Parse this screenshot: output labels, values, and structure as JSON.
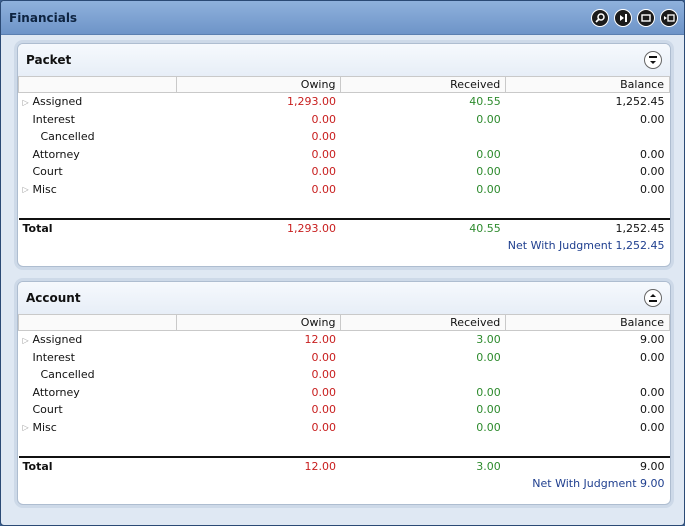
{
  "window": {
    "title": "Financials"
  },
  "colors": {
    "owing": "#c81e1e",
    "received": "#2e8b2e",
    "net": "#1f3f8f"
  },
  "panels": [
    {
      "title": "Packet",
      "columns": [
        "Owing",
        "Received",
        "Balance"
      ],
      "rows": [
        {
          "label": "Assigned",
          "expandable": true,
          "indent": 0,
          "owing": "1,293.00",
          "received": "40.55",
          "balance": "1,252.45"
        },
        {
          "label": "Interest",
          "expandable": false,
          "indent": 1,
          "owing": "0.00",
          "received": "0.00",
          "balance": "0.00"
        },
        {
          "label": "Cancelled",
          "expandable": false,
          "indent": 2,
          "owing": "0.00",
          "received": "",
          "balance": ""
        },
        {
          "label": "Attorney",
          "expandable": false,
          "indent": 1,
          "owing": "0.00",
          "received": "0.00",
          "balance": "0.00"
        },
        {
          "label": "Court",
          "expandable": false,
          "indent": 1,
          "owing": "0.00",
          "received": "0.00",
          "balance": "0.00"
        },
        {
          "label": "Misc",
          "expandable": true,
          "indent": 0,
          "owing": "0.00",
          "received": "0.00",
          "balance": "0.00"
        }
      ],
      "total": {
        "label": "Total",
        "owing": "1,293.00",
        "received": "40.55",
        "balance": "1,252.45"
      },
      "net": "Net With Judgment 1,252.45"
    },
    {
      "title": "Account",
      "columns": [
        "Owing",
        "Received",
        "Balance"
      ],
      "rows": [
        {
          "label": "Assigned",
          "expandable": true,
          "indent": 0,
          "owing": "12.00",
          "received": "3.00",
          "balance": "9.00"
        },
        {
          "label": "Interest",
          "expandable": false,
          "indent": 1,
          "owing": "0.00",
          "received": "0.00",
          "balance": "0.00"
        },
        {
          "label": "Cancelled",
          "expandable": false,
          "indent": 2,
          "owing": "0.00",
          "received": "",
          "balance": ""
        },
        {
          "label": "Attorney",
          "expandable": false,
          "indent": 1,
          "owing": "0.00",
          "received": "0.00",
          "balance": "0.00"
        },
        {
          "label": "Court",
          "expandable": false,
          "indent": 1,
          "owing": "0.00",
          "received": "0.00",
          "balance": "0.00"
        },
        {
          "label": "Misc",
          "expandable": true,
          "indent": 0,
          "owing": "0.00",
          "received": "0.00",
          "balance": "0.00"
        }
      ],
      "total": {
        "label": "Total",
        "owing": "12.00",
        "received": "3.00",
        "balance": "9.00"
      },
      "net": "Net With Judgment 9.00"
    }
  ]
}
